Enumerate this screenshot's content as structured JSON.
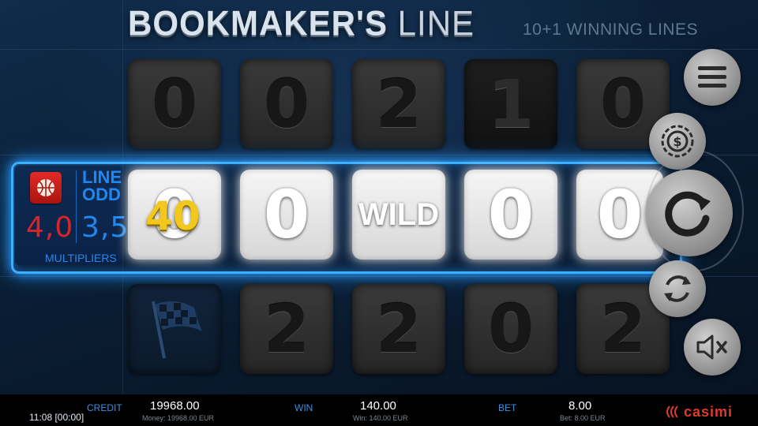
{
  "header": {
    "title_bold": "BOOKMAKER'S",
    "title_light": "LINE",
    "subtitle": "10+1 WINNING LINES"
  },
  "reels": {
    "top_row": [
      "0",
      "0",
      "2",
      "1",
      "0"
    ],
    "middle_row": [
      "0",
      "0",
      "WILD",
      "0",
      "0"
    ],
    "bottom_row": [
      "",
      "2",
      "2",
      "0",
      "2"
    ],
    "middle_first_overlay": "40"
  },
  "odds_panel": {
    "line_label": [
      "LINE",
      "ODD"
    ],
    "odd_left": "4,0",
    "odd_right": "3,5",
    "multipliers_label": "MULTIPLIERS",
    "icon": "basketball-icon"
  },
  "side_buttons": {
    "menu": "menu-icon",
    "coin": "coin-icon",
    "spin": "spin-icon",
    "autoplay": "autoplay-icon",
    "mute": "mute-icon"
  },
  "bottom_bar": {
    "credit_label": "CREDIT",
    "credit_value": "19968.00",
    "credit_sub": "Money: 19968.00 EUR",
    "win_label": "WIN",
    "win_value": "140.00",
    "win_sub": "Win: 140.00 EUR",
    "bet_label": "BET",
    "bet_value": "8.00",
    "bet_sub": "Bet: 8.00 EUR",
    "clock": "11:08 [00:00]",
    "brand": "casimi"
  },
  "colors": {
    "winline_glow": "#3ab0ff",
    "odd_red": "#d8252a",
    "odd_blue": "#1f87f0",
    "multiplier_gold": "#f2c81f",
    "brand_red": "#e03a2a"
  }
}
